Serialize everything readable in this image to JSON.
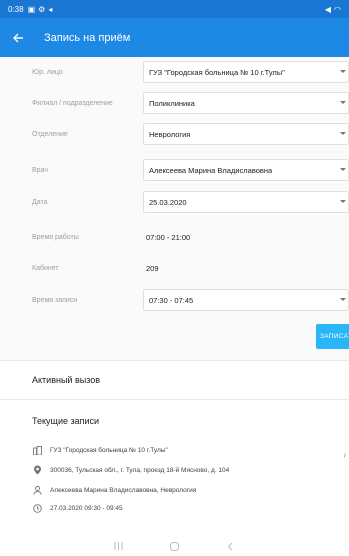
{
  "status_bar": {
    "time": "0:38"
  },
  "app_bar": {
    "title": "Запись на приём"
  },
  "form": {
    "legal_entity_label": "Юр. лицо",
    "legal_entity_value": "ГУЗ \"Городская больница № 10 г.Тулы\"",
    "branch_label": "Филиал / подразделение",
    "branch_value": "Поликлиника",
    "department_label": "Отделение",
    "department_value": "Неврология",
    "doctor_label": "Врач",
    "doctor_value": "Алексеева  Марина Владиславовна",
    "date_label": "Дата",
    "date_value": "25.03.2020",
    "work_time_label": "Время работы",
    "work_time_value": "07:00 - 21:00",
    "cabinet_label": "Кабинет",
    "cabinet_value": "209",
    "booking_time_label": "Время записи",
    "booking_time_value": "07:30 - 07:45",
    "book_button": "ЗАПИСАТ"
  },
  "active_call": {
    "title": "Активный вызов"
  },
  "current_records": {
    "title": "Текущие записи",
    "items": [
      {
        "organization": "ГУЗ \"Городская больница № 10 г.Тулы\"",
        "address": "300036, Тульская обл., г. Тула, проезд 18-й Мясново, д. 104",
        "doctor": "Алексеева  Марина Владиславовна, Неврология",
        "datetime": "27.03.2020 09:30 - 09:45"
      }
    ]
  },
  "colors": {
    "primary": "#1e88e5",
    "accent": "#29b6f6"
  }
}
